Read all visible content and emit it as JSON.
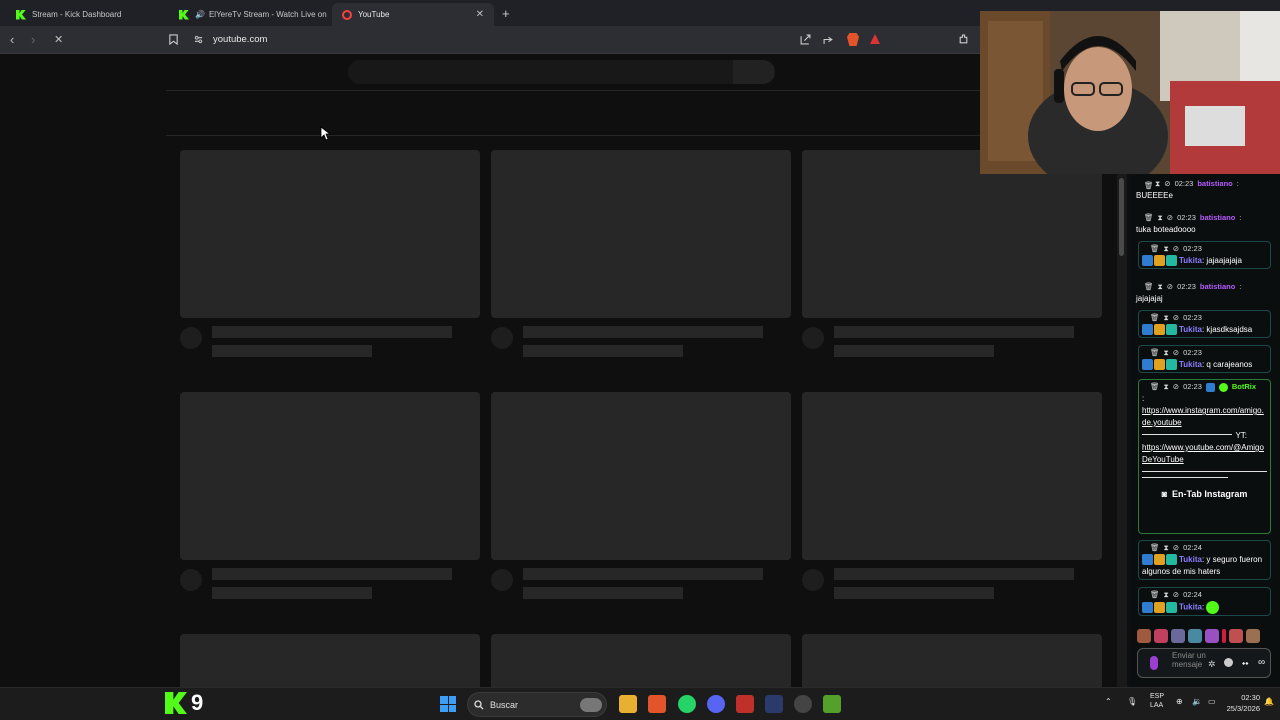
{
  "tabs": [
    {
      "label": "Stream - Kick Dashboard",
      "icon": "kick-icon"
    },
    {
      "label": "ElYereTv Stream - Watch Live on",
      "icon": "kick-icon"
    },
    {
      "label": "YouTube",
      "icon": "youtube-icon",
      "active": true
    }
  ],
  "address_bar": {
    "url": "youtube.com"
  },
  "chat": {
    "messages": [
      {
        "time": "02:23",
        "user": "batistiano",
        "text": "BUEEEEe"
      },
      {
        "time": "02:23",
        "user": "batistiano",
        "text": "tuka boteadoooo"
      },
      {
        "time": "02:23",
        "user": "Tukita",
        "text": "jajaajajaja"
      },
      {
        "time": "02:23",
        "user": "batistiano",
        "text": "jajajajaj"
      },
      {
        "time": "02:23",
        "user": "Tukita",
        "text": "kjasdksajdsa"
      },
      {
        "time": "02:23",
        "user": "Tukita",
        "text": "q carajeanos"
      },
      {
        "time": "02:23",
        "user": "BotRix",
        "colon": ":",
        "link1": "https://www.instagram.com/amigo.de.youtube",
        "yt_label": "YT:",
        "link2": "https://www.youtube.com/@AmigoDeYouTube",
        "button": "En-Tab Instagram"
      },
      {
        "time": "02:24",
        "user": "Tukita",
        "text": "y seguro fueron algunos de mis haters"
      },
      {
        "time": "02:24",
        "user": "Tukita",
        "text": ""
      }
    ],
    "input_placeholder": "Enviar un mensaje"
  },
  "taskbar": {
    "kick_number": "9",
    "search_label": "Buscar",
    "lang_line1": "ESP",
    "lang_line2": "LAA",
    "time": "02:30",
    "date": "25/3/2026"
  },
  "colors": {
    "kick_green": "#53fc18",
    "chat_purple": "#b45cff",
    "page_bg": "#0f0f0f"
  }
}
